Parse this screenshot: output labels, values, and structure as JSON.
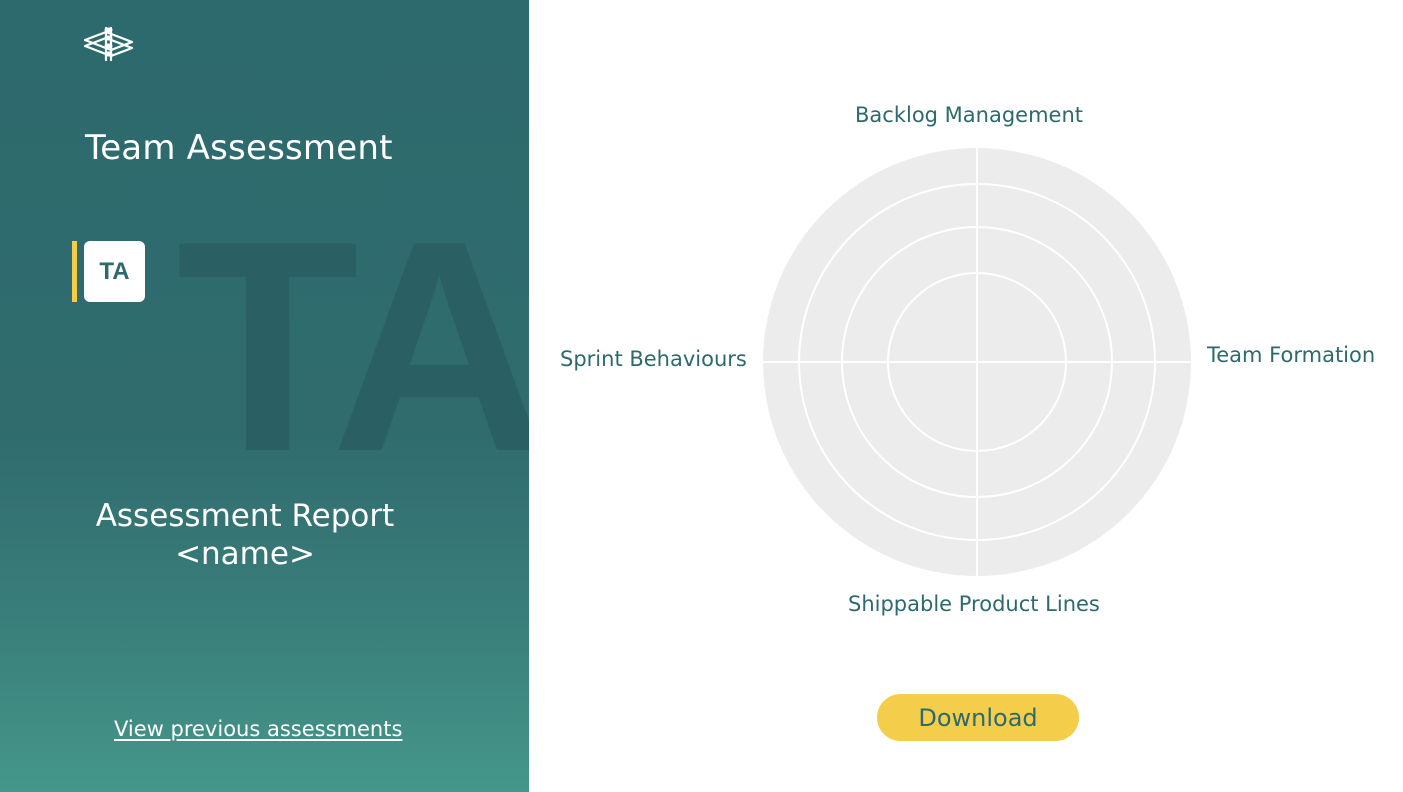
{
  "sidebar": {
    "title": "Team Assessment",
    "badge": "TA",
    "watermark": "TA",
    "report_title": "Assessment Report",
    "report_name": "<name>",
    "previous_link": "View previous assessments"
  },
  "radar": {
    "labels": {
      "top": "Backlog Management",
      "right": "Team Formation",
      "bottom": "Shippable Product Lines",
      "left": "Sprint Behaviours"
    }
  },
  "actions": {
    "download_label": "Download"
  },
  "colors": {
    "panel": "#2d6a6d",
    "accent": "#f4cd4b",
    "chart_fill": "#ececec",
    "text_teal": "#2d6a6d"
  },
  "icons": {
    "logo": "stacked-layers-logo-icon"
  }
}
